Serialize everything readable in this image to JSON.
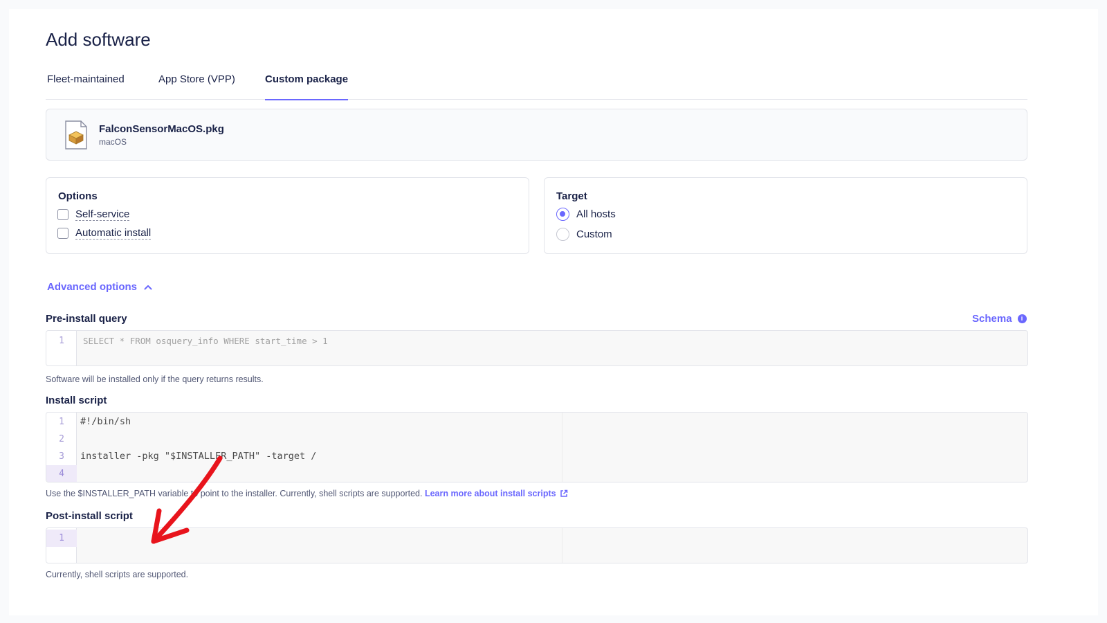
{
  "page": {
    "title": "Add software"
  },
  "tabs": [
    {
      "label": "Fleet-maintained",
      "active": false
    },
    {
      "label": "App Store (VPP)",
      "active": false
    },
    {
      "label": "Custom package",
      "active": true
    }
  ],
  "package": {
    "file_name": "FalconSensorMacOS.pkg",
    "platform": "macOS",
    "icon": "package-file-icon"
  },
  "options": {
    "title": "Options",
    "items": [
      {
        "label": "Self-service",
        "checked": false
      },
      {
        "label": "Automatic install",
        "checked": false
      }
    ]
  },
  "target": {
    "title": "Target",
    "items": [
      {
        "label": "All hosts",
        "selected": true
      },
      {
        "label": "Custom",
        "selected": false
      }
    ]
  },
  "advanced": {
    "label": "Advanced options",
    "expanded": true,
    "icon": "chevron-up-icon"
  },
  "pre_install": {
    "label": "Pre-install query",
    "schema_label": "Schema",
    "schema_icon": "info-icon",
    "line_numbers": [
      "1"
    ],
    "placeholder": "SELECT * FROM osquery_info WHERE start_time > 1",
    "help": "Software will be installed only if the query returns results."
  },
  "install_script": {
    "label": "Install script",
    "line_numbers": [
      "1",
      "2",
      "3",
      "4"
    ],
    "lines": [
      "#!/bin/sh",
      "",
      "installer -pkg \"$INSTALLER_PATH\" -target /",
      ""
    ],
    "help": "Use the $INSTALLER_PATH variable to point to the installer. Currently, shell scripts are supported.",
    "help_link": "Learn more about install scripts",
    "help_link_icon": "external-link-icon"
  },
  "post_install": {
    "label": "Post-install script",
    "line_numbers": [
      "1"
    ],
    "help": "Currently, shell scripts are supported."
  },
  "colors": {
    "accent": "#6a67fe",
    "text": "#192147",
    "annotation": "#e8141c"
  }
}
